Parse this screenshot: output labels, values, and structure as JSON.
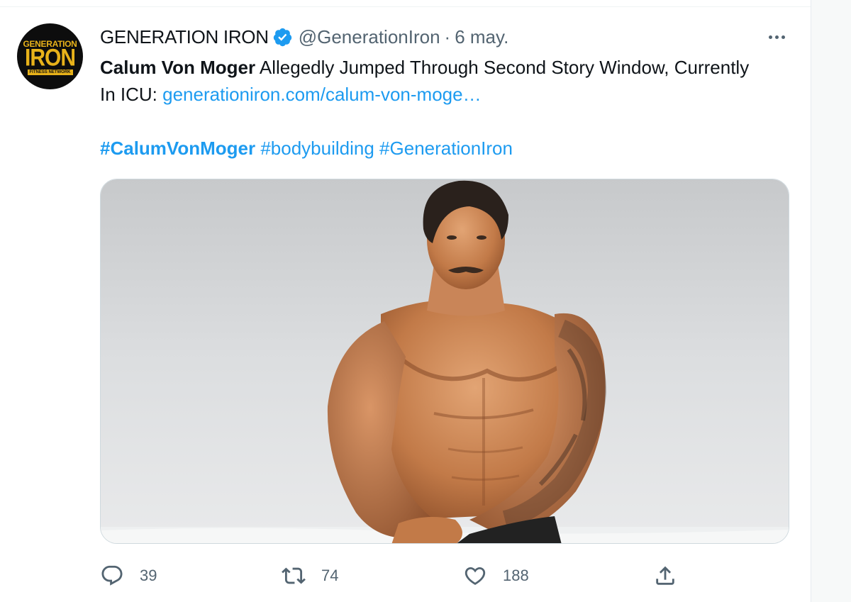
{
  "tweet": {
    "display_name": "GENERATION IRON",
    "handle": "@GenerationIron",
    "separator": "·",
    "date": "6 may.",
    "verified": true,
    "avatar": {
      "line1": "GENERATION",
      "line2": "IRON",
      "line3": "FITNESS NETWORK"
    },
    "text": {
      "bold": "Calum Von Moger",
      "rest": " Allegedly Jumped Through Second Story Window, Currently In ICU: ",
      "link": "generationiron.com/calum-von-moge…"
    },
    "hashtags": [
      "#CalumVonMoger",
      "#bodybuilding",
      "#GenerationIron"
    ],
    "media_alt": "Photo of shirtless bodybuilder posing outdoors"
  },
  "actions": {
    "reply_count": "39",
    "retweet_count": "74",
    "like_count": "188"
  },
  "icons": [
    "verified-badge-icon",
    "more-icon",
    "reply-icon",
    "retweet-icon",
    "like-icon",
    "share-icon"
  ],
  "colors": {
    "link": "#1d9bf0",
    "secondary_text": "#536471",
    "primary_text": "#0f1419",
    "logo_gold": "#e8b21a"
  }
}
